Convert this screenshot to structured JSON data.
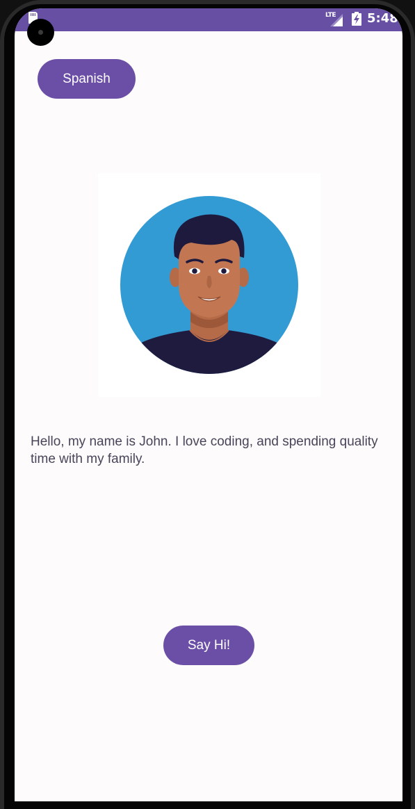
{
  "status_bar": {
    "network_label": "LTE",
    "time": "5:48",
    "icons": [
      "sd-card-icon",
      "lte-signal-icon",
      "battery-charging-icon"
    ],
    "color": "#6750a4"
  },
  "header": {
    "language_button_label": "Spanish"
  },
  "profile": {
    "avatar_description": "avatar-icon",
    "bio": "Hello, my name is John. I love coding, and spending quality time with my family."
  },
  "actions": {
    "say_hi_label": "Say Hi!"
  },
  "colors": {
    "accent": "#6b4fa6",
    "avatar_background": "#339bd4",
    "text": "#4a4458",
    "screen_background": "#fdfbfc"
  }
}
